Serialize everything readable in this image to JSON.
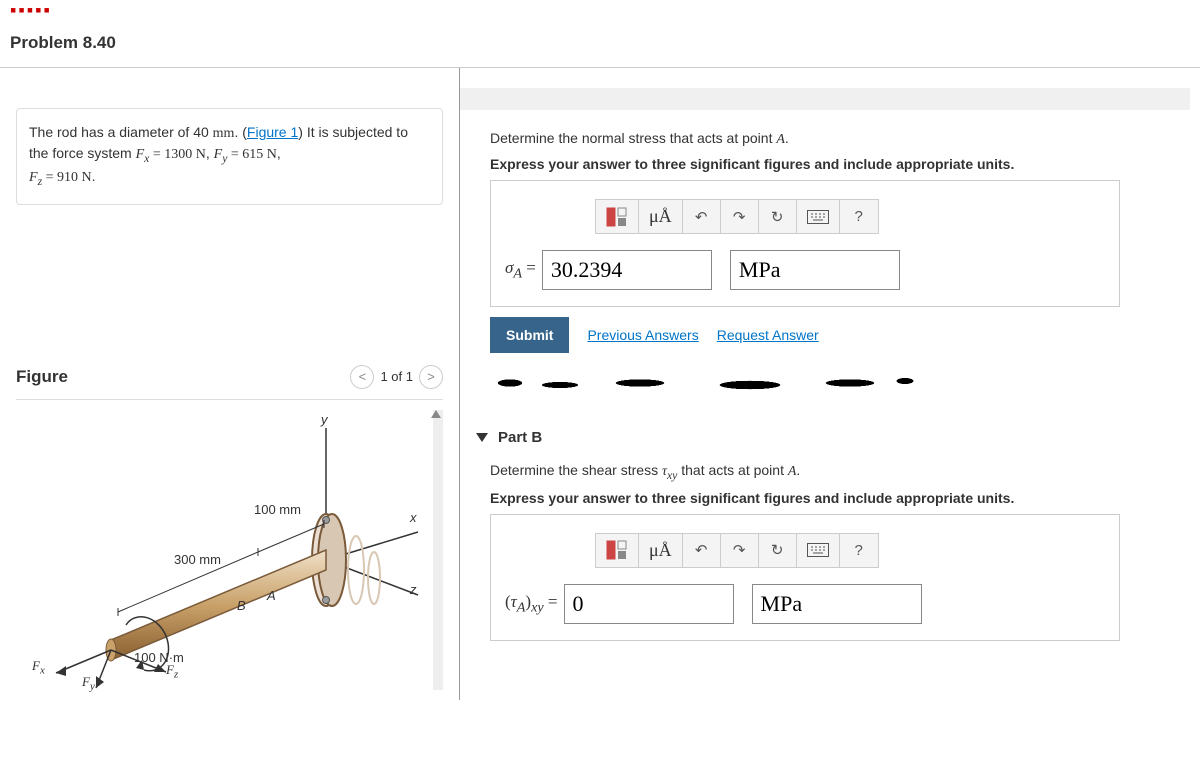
{
  "header": {
    "problem_title": "Problem 8.40"
  },
  "intro": {
    "text_a": "The rod has a diameter of 40 ",
    "mm": "mm",
    "text_b": ". (",
    "figure_link": "Figure 1",
    "text_c": ") It is subjected to the force system ",
    "eq1_lhs": "F",
    "eq1_sub": "x",
    "eq1_eq": " = 1300 N",
    "sep1": ", ",
    "eq2_lhs": "F",
    "eq2_sub": "y",
    "eq2_eq": " = 615 N",
    "sep2": ",",
    "eq3_lhs": "F",
    "eq3_sub": "z",
    "eq3_eq": " = 910 N",
    "period": "."
  },
  "figure": {
    "title": "Figure",
    "pager": "1 of 1",
    "labels": {
      "y": "y",
      "x": "x",
      "z": "z",
      "len100": "100 mm",
      "len300": "300 mm",
      "A": "A",
      "B": "B",
      "torque": "100 N·m",
      "Fx": "F",
      "Fx_sub": "x",
      "Fy": "F",
      "Fy_sub": "y",
      "Fz": "F",
      "Fz_sub": "z"
    }
  },
  "partA": {
    "prompt": "Determine the normal stress that acts at point ",
    "pointA": "A",
    "period": ".",
    "instr": "Express your answer to three significant figures and include appropriate units.",
    "toolbar": {
      "mu": "μÅ",
      "help": "?"
    },
    "lhs_sigma": "σ",
    "lhs_sub": "A",
    "lhs_eq": " = ",
    "value": "30.2394",
    "unit": "MPa",
    "submit": "Submit",
    "prev": "Previous Answers",
    "req": "Request Answer"
  },
  "partB": {
    "header": "Part B",
    "prompt_a": "Determine the shear stress ",
    "tau": "τ",
    "tau_sub": "xy",
    "prompt_b": " that acts at point ",
    "pointA": "A",
    "period": ".",
    "instr": "Express your answer to three significant figures and include appropriate units.",
    "toolbar": {
      "mu": "μÅ",
      "help": "?"
    },
    "lhs_a": "(",
    "lhs_tau": "τ",
    "lhs_sub1": "A",
    "lhs_b": ")",
    "lhs_sub2": "xy",
    "lhs_eq": " = ",
    "value": "0",
    "unit": "MPa"
  }
}
